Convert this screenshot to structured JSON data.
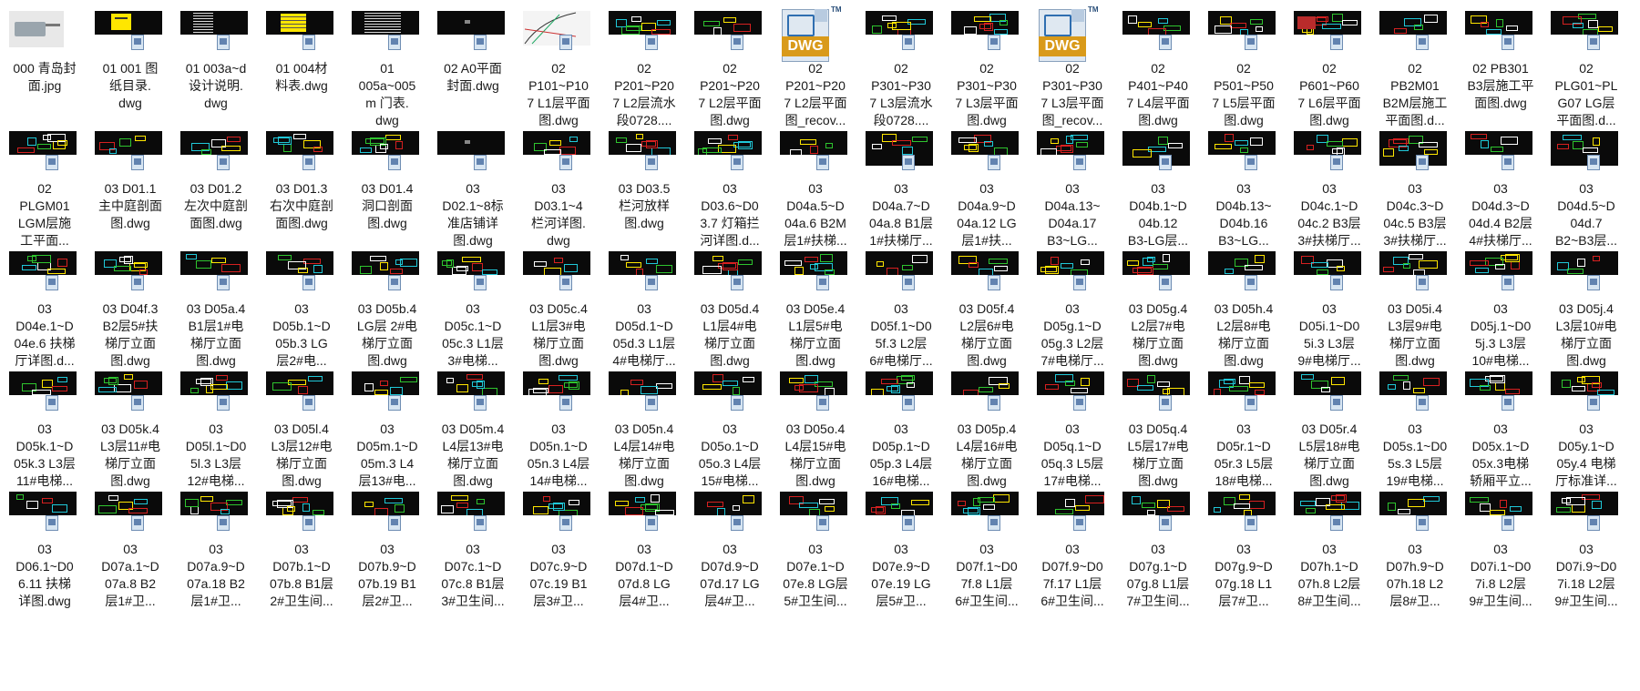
{
  "window": {
    "view_mode": "large-icons",
    "item_type_default": "dwg"
  },
  "items": [
    {
      "label": "000 青岛封\n面.jpg",
      "thumb": "gray",
      "kind": "jpg"
    },
    {
      "label": "01 001 图\n纸目录.\ndwg",
      "thumb": "yellow"
    },
    {
      "label": "01 003a~d\n设计说明.\ndwg",
      "thumb": "text"
    },
    {
      "label": "01 004材\n料表.dwg",
      "thumb": "yellowlines"
    },
    {
      "label": "01\n005a~005\nm 门表.\ndwg",
      "thumb": "table"
    },
    {
      "label": "02 A0平面\n封面.dwg",
      "thumb": "dark"
    },
    {
      "label": "02\nP101~P10\n7 L1层平面\n图.dwg",
      "thumb": "plan-white"
    },
    {
      "label": "02\nP201~P20\n7 L2层流水\n段0728....",
      "thumb": "plan"
    },
    {
      "label": "02\nP201~P20\n7 L2层平面\n图.dwg",
      "thumb": "plan"
    },
    {
      "label": "02\nP201~P20\n7 L2层平面\n图_recov...",
      "thumb": "dwgicon",
      "kind": "dwgicon"
    },
    {
      "label": "02\nP301~P30\n7 L3层流水\n段0728....",
      "thumb": "plan"
    },
    {
      "label": "02\nP301~P30\n7 L3层平面\n图.dwg",
      "thumb": "plan"
    },
    {
      "label": "02\nP301~P30\n7 L3层平面\n图_recov...",
      "thumb": "dwgicon",
      "kind": "dwgicon"
    },
    {
      "label": "02\nP401~P40\n7 L4层平面\n图.dwg",
      "thumb": "plan"
    },
    {
      "label": "02\nP501~P50\n7 L5层平面\n图.dwg",
      "thumb": "plan"
    },
    {
      "label": "02\nP601~P60\n7 L6层平面\n图.dwg",
      "thumb": "plan-red"
    },
    {
      "label": "02\nPB2M01\nB2M层施工\n平面图.d...",
      "thumb": "plan"
    },
    {
      "label": "02 PB301\nB3层施工平\n面图.dwg",
      "thumb": "plan"
    },
    {
      "label": "02\nPLG01~PL\nG07 LG层\n平面图.d...",
      "thumb": "plan"
    },
    {
      "label": "02\nPLGM01\nLGM层施\n工平面...",
      "thumb": "plan"
    },
    {
      "label": "03 D01.1\n主中庭剖面\n图.dwg",
      "thumb": "section"
    },
    {
      "label": "03 D01.2\n左次中庭剖\n面图.dwg",
      "thumb": "section"
    },
    {
      "label": "03 D01.3\n右次中庭剖\n面图.dwg",
      "thumb": "section"
    },
    {
      "label": "03 D01.4\n洞口剖面\n图.dwg",
      "thumb": "section"
    },
    {
      "label": "03\nD02.1~8标\n准店铺详\n图.dwg",
      "thumb": "dark"
    },
    {
      "label": "03\nD03.1~4\n栏河详图.\ndwg",
      "thumb": "section"
    },
    {
      "label": "03 D03.5\n栏河放样\n图.dwg",
      "thumb": "section"
    },
    {
      "label": "03\nD03.6~D0\n3.7 灯箱拦\n河详图.d...",
      "thumb": "section"
    },
    {
      "label": "03\nD04a.5~D\n04a.6 B2M\n层1#扶梯...",
      "thumb": "section"
    },
    {
      "label": "03\nD04a.7~D\n04a.8 B1层\n1#扶梯厅...",
      "thumb": "tall"
    },
    {
      "label": "03\nD04a.9~D\n04a.12 LG\n层1#扶...",
      "thumb": "section"
    },
    {
      "label": "03\nD04a.13~\nD04a.17\nB3~LG...",
      "thumb": "section"
    },
    {
      "label": "03\nD04b.1~D\n04b.12\nB3-LG层...",
      "thumb": "tall"
    },
    {
      "label": "03\nD04b.13~\nD04b.16\nB3~LG...",
      "thumb": "section"
    },
    {
      "label": "03\nD04c.1~D\n04c.2 B3层\n3#扶梯厅...",
      "thumb": "section"
    },
    {
      "label": "03\nD04c.3~D\n04c.5 B3层\n3#扶梯厅...",
      "thumb": "tall"
    },
    {
      "label": "03\nD04d.3~D\n04d.4 B2层\n4#扶梯厅...",
      "thumb": "section"
    },
    {
      "label": "03\nD04d.5~D\n04d.7\nB2~B3层...",
      "thumb": "tall"
    },
    {
      "label": "03\nD04e.1~D\n04e.6 扶梯\n厅详图.d...",
      "thumb": "section"
    },
    {
      "label": "03 D04f.3\nB2层5#扶\n梯厅立面\n图.dwg",
      "thumb": "section"
    },
    {
      "label": "03 D05a.4\nB1层1#电\n梯厅立面\n图.dwg",
      "thumb": "section"
    },
    {
      "label": "03\nD05b.1~D\n05b.3 LG\n层2#电...",
      "thumb": "section"
    },
    {
      "label": "03 D05b.4\nLG层 2#电\n梯厅立面\n图.dwg",
      "thumb": "section"
    },
    {
      "label": "03\nD05c.1~D\n05c.3 L1层\n3#电梯...",
      "thumb": "section"
    },
    {
      "label": "03 D05c.4\nL1层3#电\n梯厅立面\n图.dwg",
      "thumb": "section"
    },
    {
      "label": "03\nD05d.1~D\n05d.3 L1层\n4#电梯厅...",
      "thumb": "section"
    },
    {
      "label": "03 D05d.4\nL1层4#电\n梯厅立面\n图.dwg",
      "thumb": "section"
    },
    {
      "label": "03 D05e.4\nL1层5#电\n梯厅立面\n图.dwg",
      "thumb": "section"
    },
    {
      "label": "03\nD05f.1~D0\n5f.3 L2层\n6#电梯厅...",
      "thumb": "section"
    },
    {
      "label": "03 D05f.4\nL2层6#电\n梯厅立面\n图.dwg",
      "thumb": "section"
    },
    {
      "label": "03\nD05g.1~D\n05g.3 L2层\n7#电梯厅...",
      "thumb": "section"
    },
    {
      "label": "03 D05g.4\nL2层7#电\n梯厅立面\n图.dwg",
      "thumb": "section"
    },
    {
      "label": "03 D05h.4\nL2层8#电\n梯厅立面\n图.dwg",
      "thumb": "section"
    },
    {
      "label": "03\nD05i.1~D0\n5i.3 L3层\n9#电梯厅...",
      "thumb": "section"
    },
    {
      "label": "03 D05i.4\nL3层9#电\n梯厅立面\n图.dwg",
      "thumb": "section"
    },
    {
      "label": "03\nD05j.1~D0\n5j.3 L3层\n10#电梯...",
      "thumb": "section"
    },
    {
      "label": "03 D05j.4\nL3层10#电\n梯厅立面\n图.dwg",
      "thumb": "section"
    },
    {
      "label": "03\nD05k.1~D\n05k.3 L3层\n11#电梯...",
      "thumb": "section"
    },
    {
      "label": "03 D05k.4\nL3层11#电\n梯厅立面\n图.dwg",
      "thumb": "section"
    },
    {
      "label": "03\nD05l.1~D0\n5l.3 L3层\n12#电梯...",
      "thumb": "section"
    },
    {
      "label": "03 D05l.4\nL3层12#电\n梯厅立面\n图.dwg",
      "thumb": "section"
    },
    {
      "label": "03\nD05m.1~D\n05m.3 L4\n层13#电...",
      "thumb": "section"
    },
    {
      "label": "03 D05m.4\nL4层13#电\n梯厅立面\n图.dwg",
      "thumb": "section"
    },
    {
      "label": "03\nD05n.1~D\n05n.3 L4层\n14#电梯...",
      "thumb": "section"
    },
    {
      "label": "03 D05n.4\nL4层14#电\n梯厅立面\n图.dwg",
      "thumb": "section"
    },
    {
      "label": "03\nD05o.1~D\n05o.3 L4层\n15#电梯...",
      "thumb": "section"
    },
    {
      "label": "03 D05o.4\nL4层15#电\n梯厅立面\n图.dwg",
      "thumb": "section"
    },
    {
      "label": "03\nD05p.1~D\n05p.3 L4层\n16#电梯...",
      "thumb": "section"
    },
    {
      "label": "03 D05p.4\nL4层16#电\n梯厅立面\n图.dwg",
      "thumb": "section"
    },
    {
      "label": "03\nD05q.1~D\n05q.3 L5层\n17#电梯...",
      "thumb": "section"
    },
    {
      "label": "03 D05q.4\nL5层17#电\n梯厅立面\n图.dwg",
      "thumb": "section"
    },
    {
      "label": "03\nD05r.1~D\n05r.3 L5层\n18#电梯...",
      "thumb": "section"
    },
    {
      "label": "03 D05r.4\nL5层18#电\n梯厅立面\n图.dwg",
      "thumb": "section"
    },
    {
      "label": "03\nD05s.1~D0\n5s.3 L5层\n19#电梯...",
      "thumb": "section"
    },
    {
      "label": "03\nD05x.1~D\n05x.3电梯\n轿厢平立...",
      "thumb": "section"
    },
    {
      "label": "03\nD05y.1~D\n05y.4 电梯\n厅标准详...",
      "thumb": "section"
    },
    {
      "label": "03\nD06.1~D0\n6.11 扶梯\n详图.dwg",
      "thumb": "section"
    },
    {
      "label": "03\nD07a.1~D\n07a.8  B2\n层1#卫...",
      "thumb": "section"
    },
    {
      "label": "03\nD07a.9~D\n07a.18 B2\n层1#卫...",
      "thumb": "section"
    },
    {
      "label": "03\nD07b.1~D\n07b.8 B1层\n2#卫生间...",
      "thumb": "section"
    },
    {
      "label": "03\nD07b.9~D\n07b.19 B1\n层2#卫...",
      "thumb": "section"
    },
    {
      "label": "03\nD07c.1~D\n07c.8 B1层\n3#卫生间...",
      "thumb": "section"
    },
    {
      "label": "03\nD07c.9~D\n07c.19 B1\n层3#卫...",
      "thumb": "section"
    },
    {
      "label": "03\nD07d.1~D\n07d.8 LG\n层4#卫...",
      "thumb": "section"
    },
    {
      "label": "03\nD07d.9~D\n07d.17 LG\n层4#卫...",
      "thumb": "section"
    },
    {
      "label": "03\nD07e.1~D\n07e.8 LG层\n5#卫生间...",
      "thumb": "section"
    },
    {
      "label": "03\nD07e.9~D\n07e.19 LG\n层5#卫...",
      "thumb": "section"
    },
    {
      "label": "03\nD07f.1~D0\n7f.8 L1层\n6#卫生间...",
      "thumb": "section"
    },
    {
      "label": "03\nD07f.9~D0\n7f.17 L1层\n6#卫生间...",
      "thumb": "section"
    },
    {
      "label": "03\nD07g.1~D\n07g.8 L1层\n7#卫生间...",
      "thumb": "section"
    },
    {
      "label": "03\nD07g.9~D\n07g.18 L1\n层7#卫...",
      "thumb": "section"
    },
    {
      "label": "03\nD07h.1~D\n07h.8 L2层\n8#卫生间...",
      "thumb": "section"
    },
    {
      "label": "03\nD07h.9~D\n07h.18 L2\n层8#卫...",
      "thumb": "section"
    },
    {
      "label": "03\nD07i.1~D0\n7i.8 L2层\n9#卫生间...",
      "thumb": "section"
    },
    {
      "label": "03\nD07i.9~D0\n7i.18 L2层\n9#卫生间...",
      "thumb": "section"
    }
  ],
  "icons": {
    "file_badge": "document-shortcut-icon",
    "dwg_logo": "dwg-logo-icon",
    "dwg_text": "DWG",
    "tm": "TM"
  },
  "colors": {
    "thumb_bg": "#0a0a0a",
    "cad_yellow": "#ffe600",
    "cad_red": "#d62020",
    "cad_cyan": "#20c8d8",
    "cad_green": "#2ec42e",
    "dwg_orange": "#d99a1a"
  }
}
